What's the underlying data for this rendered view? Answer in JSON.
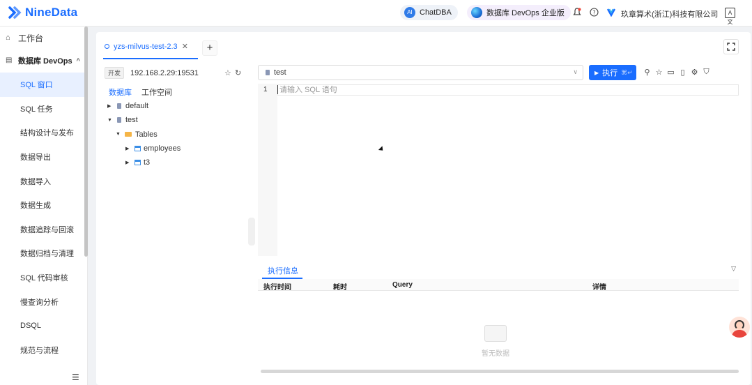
{
  "header": {
    "logo_text": "NineData",
    "chatdba_label": "ChatDBA",
    "chatdba_badge": "AI",
    "edition_label": "数据库 DevOps 企业版",
    "company": "玖章算术(浙江)科技有限公司",
    "lang_label": "A文"
  },
  "sidebar": {
    "top_item": "工作台",
    "group_label": "数据库 DevOps",
    "items": [
      {
        "label": "SQL 窗口",
        "active": true
      },
      {
        "label": "SQL 任务"
      },
      {
        "label": "结构设计与发布"
      },
      {
        "label": "数据导出"
      },
      {
        "label": "数据导入"
      },
      {
        "label": "数据生成"
      },
      {
        "label": "数据追踪与回滚"
      },
      {
        "label": "数据归档与清理"
      },
      {
        "label": "SQL 代码审核"
      },
      {
        "label": "慢查询分析"
      },
      {
        "label": "DSQL"
      },
      {
        "label": "规范与流程"
      }
    ]
  },
  "tab": {
    "title": "yzs-milvus-test-2.3",
    "add_label": "+"
  },
  "connection": {
    "env": "开发",
    "address": "192.168.2.29:19531"
  },
  "panel_tabs": [
    "数据库",
    "工作空间"
  ],
  "tree": {
    "db1": "default",
    "db2": "test",
    "folder": "Tables",
    "table1": "employees",
    "table2": "t3"
  },
  "editor": {
    "selected_db": "test",
    "run_label": "执行",
    "run_kbd": "⌘↵",
    "line_number": "1",
    "placeholder": "请输入 SQL 语句"
  },
  "results": {
    "tab_label": "执行信息",
    "columns": [
      "执行时间",
      "耗时",
      "Query",
      "详情"
    ],
    "empty_text": "暂无数据"
  },
  "colors": {
    "accent": "#1a6dff"
  }
}
